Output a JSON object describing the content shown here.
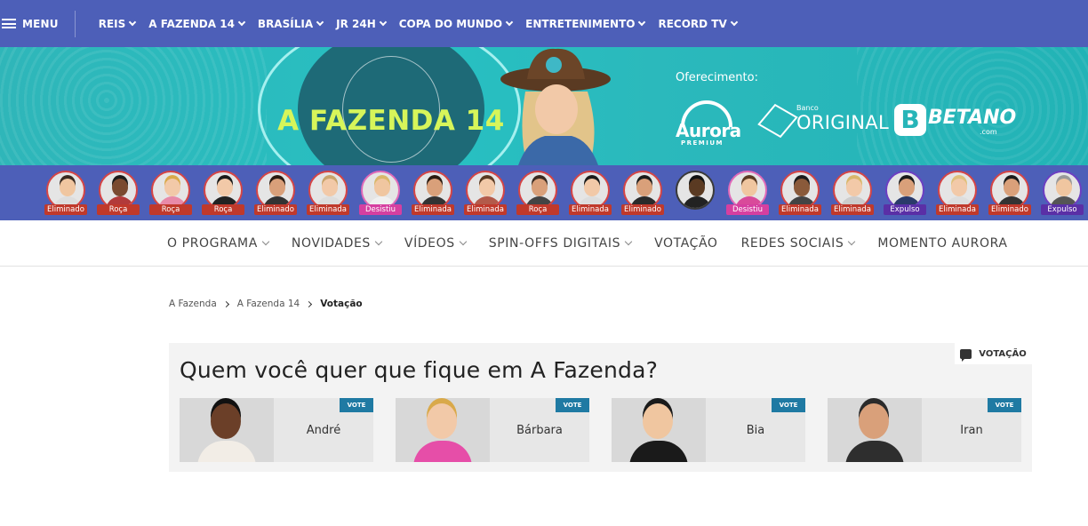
{
  "topnav": {
    "menu_label": "MENU",
    "items": [
      {
        "label": "REIS"
      },
      {
        "label": "A FAZENDA 14"
      },
      {
        "label": "BRASÍLIA"
      },
      {
        "label": "JR 24H"
      },
      {
        "label": "COPA DO MUNDO"
      },
      {
        "label": "ENTRETENIMENTO"
      },
      {
        "label": "RECORD TV"
      }
    ]
  },
  "banner": {
    "logo": "A FAZENDA 14",
    "offer_label": "Oferecimento:",
    "sponsors": {
      "aurora": {
        "name": "Aurora",
        "sub": "PREMIUM"
      },
      "original": {
        "small": "Banco",
        "name": "ORIGINAL"
      },
      "betano": {
        "mark": "B",
        "name": "BETANO",
        "domain": ".com"
      }
    }
  },
  "participants": [
    {
      "status": "Eliminado"
    },
    {
      "status": "Roça"
    },
    {
      "status": "Roça"
    },
    {
      "status": "Roça"
    },
    {
      "status": "Eliminado"
    },
    {
      "status": "Eliminada"
    },
    {
      "status": "Desistiu"
    },
    {
      "status": "Eliminada"
    },
    {
      "status": "Eliminada"
    },
    {
      "status": "Roça"
    },
    {
      "status": "Eliminada"
    },
    {
      "status": "Eliminado"
    },
    {
      "status": ""
    },
    {
      "status": "Desistiu"
    },
    {
      "status": "Eliminada"
    },
    {
      "status": "Eliminada"
    },
    {
      "status": "Expulso"
    },
    {
      "status": "Eliminada"
    },
    {
      "status": "Eliminado"
    },
    {
      "status": "Expulso"
    }
  ],
  "colors": {
    "nav_blue": "#4d5fb8",
    "teal": "#2bb9bc",
    "badge_red": "#c0392b",
    "badge_pink": "#d63fa0",
    "badge_purple": "#5a2fa6",
    "vote_blue": "#1f7aa3"
  },
  "subnav": {
    "items": [
      {
        "label": "O PROGRAMA",
        "dropdown": true
      },
      {
        "label": "NOVIDADES",
        "dropdown": true
      },
      {
        "label": "VÍDEOS",
        "dropdown": true
      },
      {
        "label": "SPIN-OFFS DIGITAIS",
        "dropdown": true
      },
      {
        "label": "VOTAÇÃO",
        "dropdown": false
      },
      {
        "label": "REDES SOCIAIS",
        "dropdown": true
      },
      {
        "label": "MOMENTO AURORA",
        "dropdown": false
      }
    ]
  },
  "breadcrumb": {
    "items": [
      "A Fazenda",
      "A Fazenda 14"
    ],
    "current": "Votação"
  },
  "poll": {
    "tag": "VOTAÇÃO",
    "title": "Quem você quer que fique em A Fazenda?",
    "vote_label": "VOTE",
    "candidates": [
      {
        "name": "André"
      },
      {
        "name": "Bárbara"
      },
      {
        "name": "Bia"
      },
      {
        "name": "Iran"
      }
    ]
  }
}
